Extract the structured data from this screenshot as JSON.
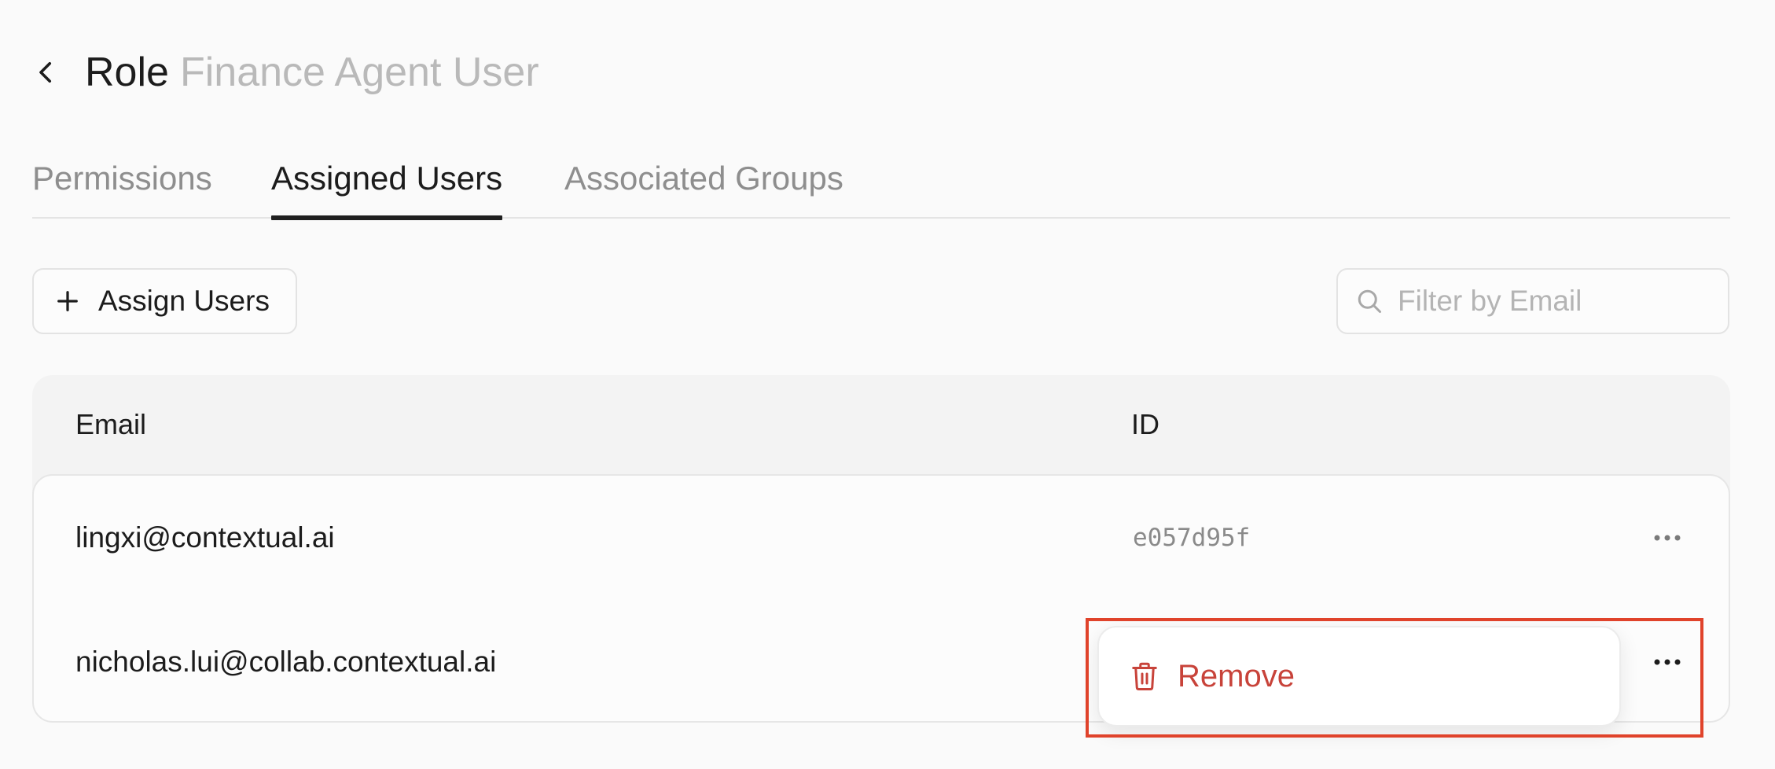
{
  "header": {
    "role_label": "Role",
    "role_name": "Finance Agent User"
  },
  "tabs": [
    {
      "label": "Permissions",
      "active": false
    },
    {
      "label": "Assigned Users",
      "active": true
    },
    {
      "label": "Associated Groups",
      "active": false
    }
  ],
  "toolbar": {
    "assign_label": "Assign Users",
    "filter_placeholder": "Filter by Email",
    "filter_value": ""
  },
  "table": {
    "columns": [
      "Email",
      "ID"
    ],
    "rows": [
      {
        "email": "lingxi@contextual.ai",
        "id": "e057d95f"
      },
      {
        "email": "nicholas.lui@collab.contextual.ai",
        "id": ""
      }
    ]
  },
  "context_menu": {
    "items": [
      {
        "label": "Remove",
        "icon": "trash-icon"
      }
    ]
  },
  "colors": {
    "danger": "#c8433a",
    "highlight": "#e0432b",
    "muted_text": "#b9b9b9",
    "active_tab_underline": "#1f1f1f"
  }
}
